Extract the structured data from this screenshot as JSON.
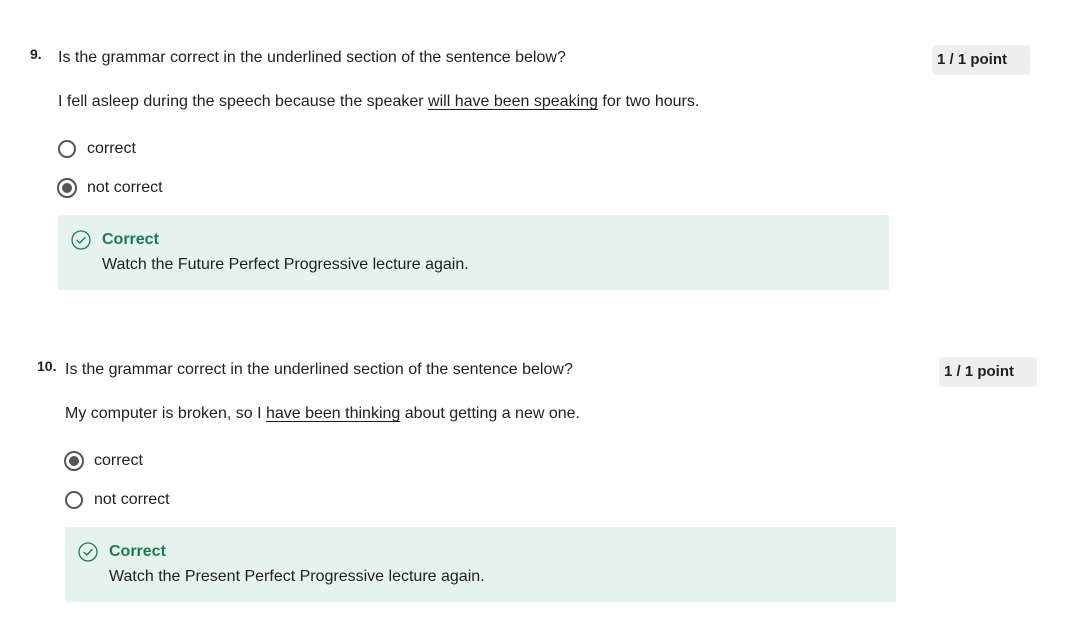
{
  "questions": [
    {
      "number": "9.",
      "prompt": "Is the grammar correct in the underlined section of the sentence below?",
      "sentence_before": "I fell asleep during the speech because the speaker ",
      "sentence_underlined": "will have been speaking",
      "sentence_after": " for two hours.",
      "options": [
        {
          "label": "correct",
          "selected": false
        },
        {
          "label": "not correct",
          "selected": true
        }
      ],
      "feedback_title": "Correct",
      "feedback_text": "Watch the Future Perfect Progressive lecture again.",
      "points": "1 / 1 point"
    },
    {
      "number": "10.",
      "prompt": "Is the grammar correct in the underlined section of the sentence below?",
      "sentence_before": "My computer is broken, so I ",
      "sentence_underlined": "have been thinking",
      "sentence_after": " about getting a new one.",
      "options": [
        {
          "label": "correct",
          "selected": true
        },
        {
          "label": "not correct",
          "selected": false
        }
      ],
      "feedback_title": "Correct",
      "feedback_text": "Watch the Present Perfect Progressive lecture again.",
      "points": "1 / 1 point"
    }
  ],
  "colors": {
    "feedback_bg": "#e6f2ee",
    "correct_green": "#1e7b4b",
    "points_bg": "#eeeeee"
  }
}
